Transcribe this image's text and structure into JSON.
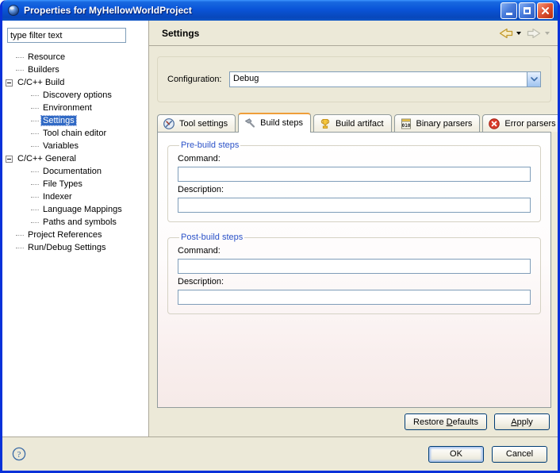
{
  "window": {
    "title": "Properties for MyHellowWorldProject"
  },
  "sidebar": {
    "filter_value": "type filter text",
    "items": [
      {
        "label": "Resource"
      },
      {
        "label": "Builders"
      },
      {
        "label": "C/C++ Build"
      },
      {
        "label": "Discovery options"
      },
      {
        "label": "Environment"
      },
      {
        "label": "Settings"
      },
      {
        "label": "Tool chain editor"
      },
      {
        "label": "Variables"
      },
      {
        "label": "C/C++ General"
      },
      {
        "label": "Documentation"
      },
      {
        "label": "File Types"
      },
      {
        "label": "Indexer"
      },
      {
        "label": "Language Mappings"
      },
      {
        "label": "Paths and symbols"
      },
      {
        "label": "Project References"
      },
      {
        "label": "Run/Debug Settings"
      }
    ]
  },
  "header": {
    "title": "Settings"
  },
  "main": {
    "configuration_label": "Configuration:",
    "configuration_value": "Debug",
    "tabs": [
      {
        "label": "Tool settings"
      },
      {
        "label": "Build steps"
      },
      {
        "label": "Build artifact"
      },
      {
        "label": "Binary parsers"
      },
      {
        "label": "Error parsers"
      }
    ],
    "groups": [
      {
        "title": "Pre-build steps",
        "command_label": "Command:",
        "command_value": "",
        "description_label": "Description:",
        "description_value": ""
      },
      {
        "title": "Post-build steps",
        "command_label": "Command:",
        "command_value": "",
        "description_label": "Description:",
        "description_value": ""
      }
    ],
    "restore_defaults": {
      "pre": "Restore ",
      "key": "D",
      "post": "efaults"
    },
    "apply": {
      "pre": "",
      "key": "A",
      "post": "pply"
    }
  },
  "footer": {
    "ok": "OK",
    "cancel": "Cancel"
  },
  "colors": {
    "titlebar_blue": "#0a54d8",
    "window_border_blue": "#0831d9",
    "selection_blue": "#316ac5",
    "tab_active_orange": "#ef9e39",
    "group_title_blue": "#2b52c8",
    "error_red": "#d93a2b",
    "dialog_beige": "#ece9d8",
    "input_border": "#7f9db9"
  }
}
